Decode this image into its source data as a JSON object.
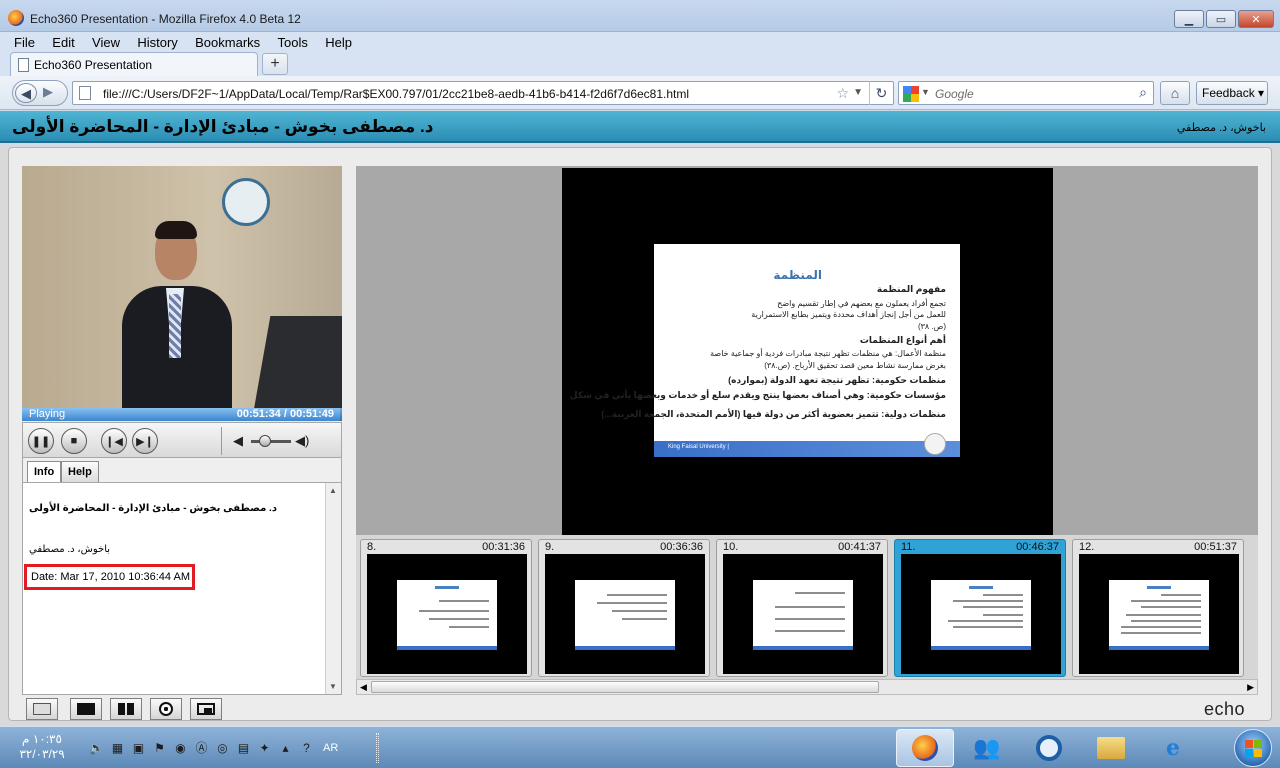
{
  "window": {
    "title": "Echo360 Presentation - Mozilla Firefox 4.0 Beta 12",
    "controls": [
      "minimize-icon",
      "maximize-icon",
      "close-icon"
    ]
  },
  "menu": [
    "File",
    "Edit",
    "View",
    "History",
    "Bookmarks",
    "Tools",
    "Help"
  ],
  "tab": {
    "label": "Echo360 Presentation"
  },
  "nav": {
    "url": "file:///C:/Users/DF2F~1/AppData/Local/Temp/Rar$EX00.797/01/2cc21be8-aedb-41b6-b414-f2d6f7d6ec81.html",
    "search_placeholder": "Google",
    "feedback_label": "Feedback"
  },
  "header": {
    "title": "د. مصطفى بخوش - مبادئ الإدارة - المحاضرة الأولى",
    "presenter": "باخوش، د. مصطفي"
  },
  "player": {
    "status": "Playing",
    "time": "00:51:34 / 00:51:49",
    "progress_fraction": 0.995
  },
  "info_tabs": [
    "Info",
    "Help"
  ],
  "info": {
    "lecture": "د. مصطفى بخوش - مبادئ الإدارة - المحاضرة الأولى",
    "presenter": "باخوش، د. مصطفي",
    "date": "Date: Mar 17, 2010 10:36:44 AM"
  },
  "slide": {
    "title": "المنظمة",
    "lines": [
      {
        "text": "مفهوم المنظمة",
        "bold": true
      },
      {
        "text": "تجمع أفراد يعملون مع بعضهم في إطار تقسيم واضح",
        "bold": false
      },
      {
        "text": "للعمل من أجل إنجاز أهداف محددة ويتميز بطابع الاستمرارية",
        "bold": false
      },
      {
        "text": "(ص. ٣٨)",
        "bold": false
      },
      {
        "text": "أهم أنواع المنظمات",
        "bold": true
      },
      {
        "text": "منظمة الأعمال: هي منظمات تظهر نتيجة مبادرات فردية أو جماعية خاصة",
        "bold": false
      },
      {
        "text": "بغرض ممارسة نشاط معين قصد تحقيق الأرباح. (ص.٣٨)",
        "bold": false
      },
      {
        "text": "منظمات حكومية: تظهر نتيجة تعهد الدولة (بموارده)",
        "bold": true
      },
      {
        "text": "مؤسسات حكومية: وهي أصناف بعضها ينتج ويقدم سلع أو خدمات وبعضها يأتي في شكل",
        "bold": true
      },
      {
        "text": "منظمات دولية: تتميز بعضوية أكثر من دولة فيها (الأمم المتحدة، الجمعة العربية...)",
        "bold": true
      }
    ],
    "footer": "King Faisal University |"
  },
  "thumbnails": [
    {
      "num": "8.",
      "time": "00:31:36",
      "active": false
    },
    {
      "num": "9.",
      "time": "00:36:36",
      "active": false
    },
    {
      "num": "10.",
      "time": "00:41:37",
      "active": false
    },
    {
      "num": "11.",
      "time": "00:46:37",
      "active": true
    },
    {
      "num": "12.",
      "time": "00:51:37",
      "active": false
    }
  ],
  "logo": "echo",
  "taskbar": {
    "time": "١٠:٣٥ م",
    "date": "٣٢/٠٣/٢٩",
    "lang": "AR"
  },
  "colors": {
    "accent": "#2fa3d6",
    "header": "#3a9fc4",
    "highlight_box": "#e21b23"
  }
}
